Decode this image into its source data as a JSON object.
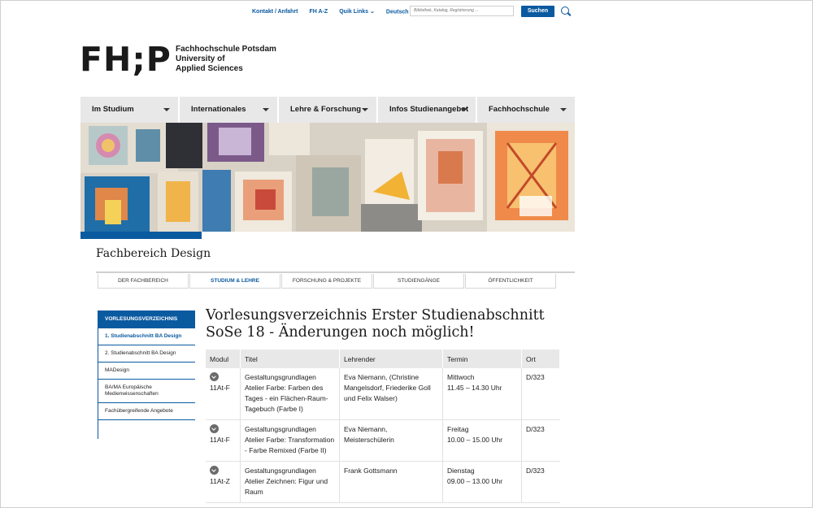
{
  "topbar": {
    "links": [
      "Kontakt / Anfahrt",
      "FH A-Z",
      "Quik Links",
      "Deutsch"
    ],
    "search_placeholder": "Bibliothek, Katalog, Registrierung ...",
    "search_button": "Suchen"
  },
  "logo": {
    "mark": "FH;P",
    "line1": "Fachhochschule Potsdam",
    "line2": "University of",
    "line3": "Applied Sciences"
  },
  "mainnav": {
    "items": [
      "Im Studium",
      "Internationales",
      "Lehre & Forschung",
      "Infos Studienangebot",
      "Fachhochschule"
    ]
  },
  "department": "Fachbereich Design",
  "subnav": {
    "items": [
      "DER FACHBEREICH",
      "STUDIUM & LEHRE",
      "FORSCHUNG & PROJEKTE",
      "STUDIENGÄNGE",
      "ÖFFENTLICHKEIT"
    ],
    "active": "STUDIUM & LEHRE"
  },
  "sidebar": {
    "heading": "VORLESUNGSVERZEICHNIS",
    "items": [
      "1. Studienabschnitt BA Design",
      "2. Studienabschnitt BA Design",
      "MADesign",
      "BA/MA Europäische Medienwissenschaften",
      "Fachübergreifende Angebote"
    ]
  },
  "page_title": "Vorlesungsverzeichnis Erster Studienabschnitt SoSe 18 - Änderungen noch möglich!",
  "table": {
    "headers": [
      "Modul",
      "Titel",
      "Lehrender",
      "Termin",
      "Ort"
    ],
    "rows": [
      {
        "modul": "11At-F",
        "titel": "Gestaltungsgrundlagen Atelier Farbe: Farben des Tages - ein Flächen-Raum-Tagebuch (Farbe I)",
        "lehrender": "Eva Niemann, (Christine Mangelsdorf, Friederike Goll und Felix Walser)",
        "termin_day": "Mittwoch",
        "termin_time": "11.45 – 14.30 Uhr",
        "ort": "D/323"
      },
      {
        "modul": "11At-F",
        "titel": "Gestaltungsgrundlagen Atelier Farbe: Transformation - Farbe Remixed (Farbe II)",
        "lehrender": "Eva Niemann, Meisterschülerin",
        "termin_day": "Freitag",
        "termin_time": "10.00 – 15.00 Uhr",
        "ort": "D/323"
      },
      {
        "modul": "11At-Z",
        "titel": "Gestaltungsgrundlagen Atelier Zeichnen: Figur und Raum",
        "lehrender": "Frank Gottsmann",
        "termin_day": "Dienstag",
        "termin_time": "09.00 – 13.00 Uhr",
        "ort": "D/323"
      }
    ]
  },
  "colors": {
    "accent": "#0a5aa0",
    "nav_bg": "#e8e8e8"
  }
}
